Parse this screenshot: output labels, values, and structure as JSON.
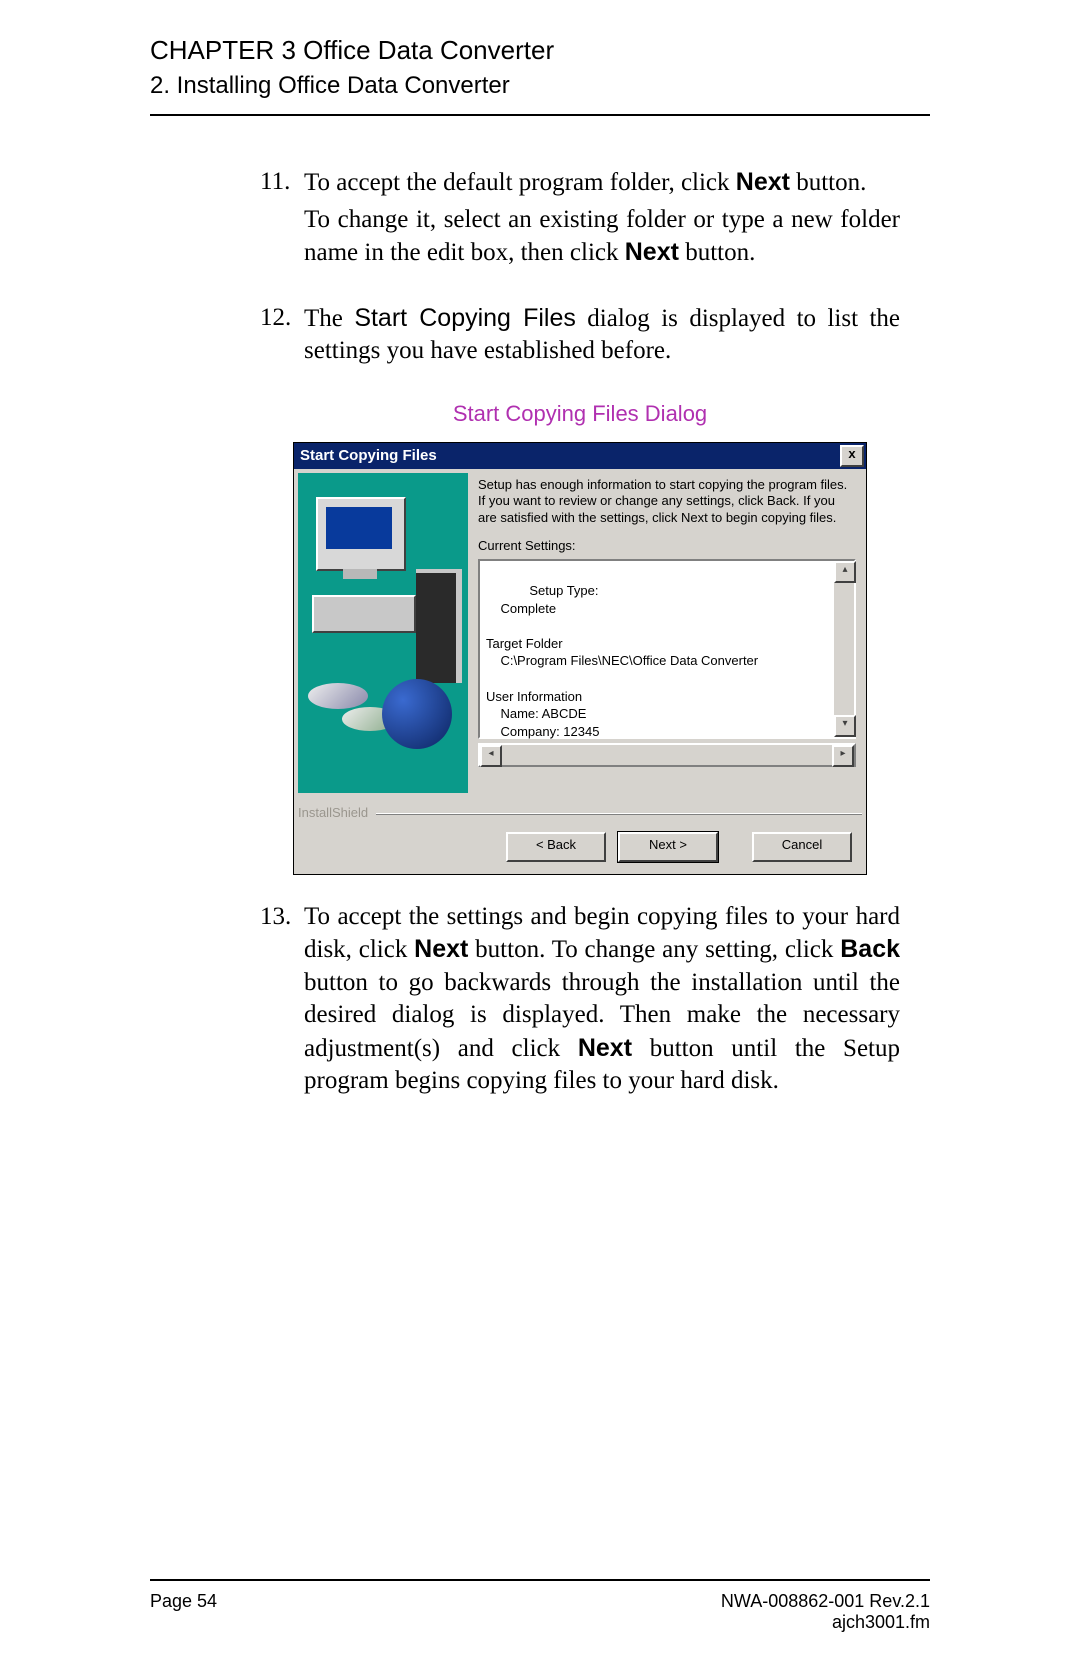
{
  "header": {
    "chapter": "CHAPTER 3 Office Data Converter",
    "section": "2. Installing Office Data Converter"
  },
  "steps": {
    "s11": {
      "num": "11.",
      "p1a": "To accept the default program folder, click ",
      "p1b": "Next",
      "p1c": " button.",
      "p2a": "To change it, select an existing folder or type a new folder name in the edit box, then click ",
      "p2b": "Next",
      "p2c": " button."
    },
    "s12": {
      "num": "12.",
      "p1a": "The ",
      "p1b": "Start Copying Files",
      "p1c": " dialog is displayed to list the settings you have established before."
    },
    "s13": {
      "num": "13.",
      "p1a": "To accept the settings and begin copying files to your hard disk, click ",
      "p1b": "Next",
      "p1c": " button. To change any setting, click ",
      "p1d": "Back",
      "p1e": " button to go backwards through the installation until the desired dialog is displayed. Then make the necessary adjustment(s) and click ",
      "p1f": "Next",
      "p1g": " button until the Setup program begins copying files to your hard disk."
    }
  },
  "caption": "Start Copying Files Dialog",
  "dialog": {
    "title": "Start Copying Files",
    "close": "x",
    "instruction": "Setup has enough information to start copying the program files. If you want to review or change any settings, click Back.  If you are satisfied with the settings, click Next to begin copying files.",
    "cs_label": "Current Settings:",
    "settings_text": "Setup Type:\n    Complete\n\nTarget Folder\n    C:\\Program Files\\NEC\\Office Data Converter\n\nUser Information\n    Name: ABCDE\n    Company: 12345",
    "brand": "InstallShield",
    "back": "< Back",
    "next": "Next >",
    "cancel": "Cancel",
    "up": "▴",
    "down": "▾",
    "left": "◂",
    "right": "▸"
  },
  "footer": {
    "page": "Page 54",
    "doc": "NWA-008862-001 Rev.2.1",
    "file": "ajch3001.fm"
  }
}
